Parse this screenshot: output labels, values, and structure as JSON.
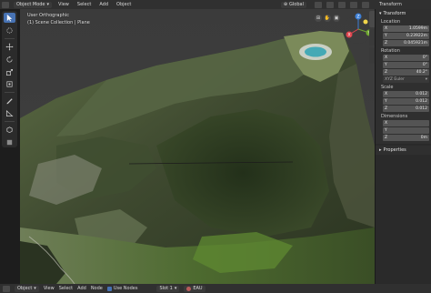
{
  "header": {
    "mode": "Object Mode",
    "menus": [
      "View",
      "Select",
      "Add",
      "Object"
    ],
    "transform_orientation": "Global"
  },
  "right_panel_tabs": [
    "Transform"
  ],
  "viewport": {
    "view_name": "User Orthographic",
    "collection": "(1) Scene Collection | Plane",
    "gizmo_axes": [
      "Z",
      "Y",
      "X"
    ]
  },
  "sidebar": {
    "title": "Transform",
    "location_label": "Location",
    "location": [
      {
        "axis": "X",
        "value": "1.0599m"
      },
      {
        "axis": "Y",
        "value": "0.23922m"
      },
      {
        "axis": "Z",
        "value": "0.045921m"
      }
    ],
    "rotation_label": "Rotation",
    "rotation": [
      {
        "axis": "X",
        "value": "0°"
      },
      {
        "axis": "Y",
        "value": "0°"
      },
      {
        "axis": "Z",
        "value": "40.2°"
      }
    ],
    "rotation_mode": "XYZ Euler",
    "scale_label": "Scale",
    "scale": [
      {
        "axis": "X",
        "value": "0.012"
      },
      {
        "axis": "Y",
        "value": "0.012"
      },
      {
        "axis": "Z",
        "value": "0.012"
      }
    ],
    "dimensions_label": "Dimensions",
    "dimensions": [
      {
        "axis": "X",
        "value": ""
      },
      {
        "axis": "Y",
        "value": ""
      },
      {
        "axis": "Z",
        "value": "0m"
      }
    ],
    "properties_label": "Properties"
  },
  "status_bar": {
    "mode": "Object",
    "menus": [
      "View",
      "Select",
      "Add",
      "Node"
    ],
    "use_nodes": "Use Nodes",
    "slot": "Slot 1",
    "material": "EAU"
  },
  "colors": {
    "accent": "#4772b3",
    "x_axis": "#e0454e",
    "y_axis": "#70a830",
    "z_axis": "#3d7fd6"
  }
}
